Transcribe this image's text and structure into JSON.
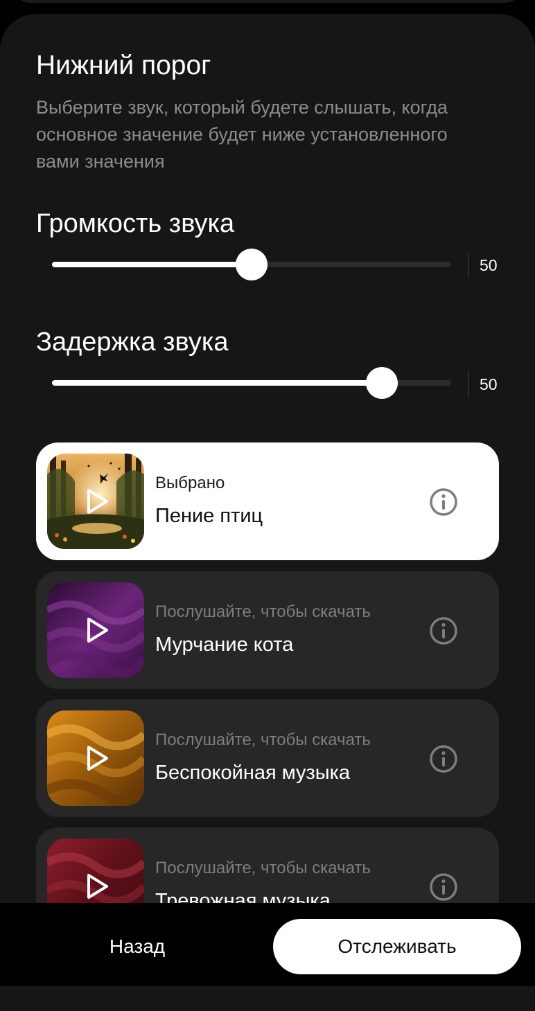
{
  "header": {
    "title": "Нижний порог",
    "description": "Выберите звук, который будете слышать, когда основное значение будет ниже установленного вами значения"
  },
  "volume": {
    "label": "Громкость звука",
    "value": "50",
    "level": 0.5
  },
  "delay": {
    "label": "Задержка звука",
    "value": "50",
    "level": 0.826
  },
  "sounds": [
    {
      "status": "Выбрано",
      "name": "Пение птиц",
      "selected": true,
      "artwork": "forest-sunset-birds",
      "icons": [
        "play-icon",
        "info-icon"
      ]
    },
    {
      "status": "Послушайте, чтобы скачать",
      "name": "Мурчание кота",
      "selected": false,
      "artwork": "purple-waves",
      "colors": [
        "#3a0f45",
        "#7a2f8a"
      ]
    },
    {
      "status": "Послушайте, чтобы скачать",
      "name": "Беспокойная музыка",
      "selected": false,
      "artwork": "amber-waves",
      "colors": [
        "#6b3a05",
        "#e89a1f"
      ]
    },
    {
      "status": "Послушайте, чтобы скачать",
      "name": "Тревожная музыка",
      "selected": false,
      "artwork": "crimson-waves",
      "colors": [
        "#4a0a12",
        "#a32a36"
      ]
    }
  ],
  "footer": {
    "back_label": "Назад",
    "track_label": "Отслеживать"
  },
  "colors": {
    "background": "#161616",
    "card": "#272727",
    "selected_card": "#ffffff",
    "accent": "#ffffff"
  }
}
